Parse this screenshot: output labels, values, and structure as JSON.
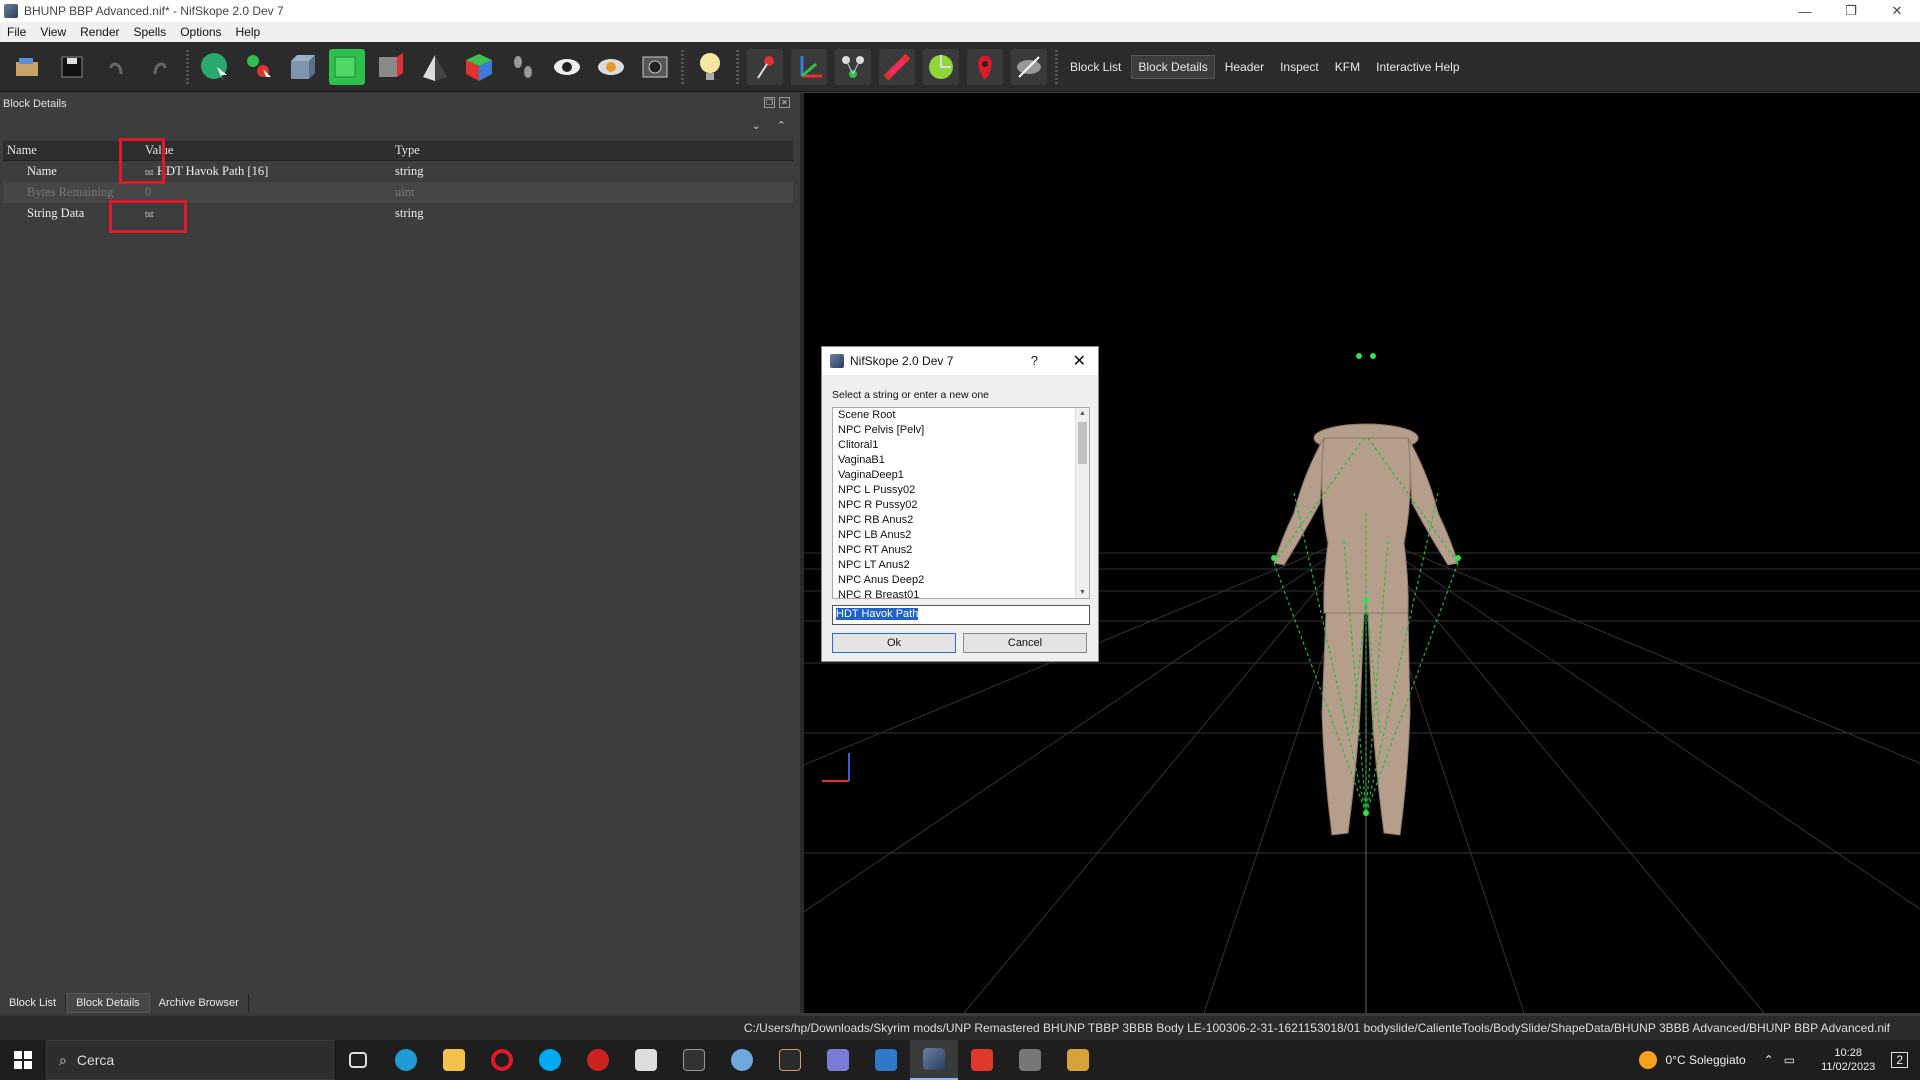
{
  "window": {
    "title": "BHUNP BBP Advanced.nif* - NifSkope 2.0 Dev 7",
    "min": "—",
    "restore": "❐",
    "close": "✕"
  },
  "menu": [
    "File",
    "View",
    "Render",
    "Spells",
    "Options",
    "Help"
  ],
  "toolbar": {
    "icons": [
      "load-icon",
      "save-icon",
      "undo-icon",
      "redo-icon",
      "select-icon",
      "transform-icon",
      "cube-icon",
      "green-cube-icon",
      "red-cube-icon",
      "shade-icon",
      "color-cube-icon",
      "footprints-icon",
      "eye-icon",
      "eye-outline-icon",
      "camera-icon",
      "lightbulb-icon",
      "pin-icon",
      "axes-icon",
      "nodes-icon",
      "bone-icon",
      "collision-icon",
      "marker-icon",
      "hidden-icon"
    ],
    "tabs": [
      "Block List",
      "Block Details",
      "Header",
      "Inspect",
      "KFM",
      "Interactive Help"
    ],
    "active_tab": "Block Details"
  },
  "block_details": {
    "title": "Block Details",
    "columns": {
      "name": "Name",
      "value": "Value",
      "type": "Type"
    },
    "rows": [
      {
        "name": "Name",
        "value": "HDT Havok Path [16]",
        "type": "string"
      },
      {
        "name": "Bytes Remaining",
        "value": "0",
        "type": "uint"
      },
      {
        "name": "String Data",
        "value": "",
        "type": "string"
      }
    ],
    "txt_icon": "txt"
  },
  "bottom_tabs": [
    "Block List",
    "Block Details",
    "Archive Browser"
  ],
  "dialog": {
    "title": "NifSkope 2.0 Dev 7",
    "help": "?",
    "close": "✕",
    "prompt": "Select a string or enter a new one",
    "items": [
      "Scene Root",
      "NPC Pelvis [Pelv]",
      "Clitoral1",
      "VaginaB1",
      "VaginaDeep1",
      "NPC L Pussy02",
      "NPC R Pussy02",
      "NPC RB Anus2",
      "NPC LB Anus2",
      "NPC RT Anus2",
      "NPC LT Anus2",
      "NPC Anus Deep2",
      "NPC R Breast01"
    ],
    "input_value": "HDT Havok Path",
    "ok": "Ok",
    "cancel": "Cancel"
  },
  "status": {
    "path": "C:/Users/hp/Downloads/Skyrim mods/UNP Remastered BHUNP TBBP 3BBB Body LE-100306-2-31-1621153018/01 bodyslide/CalienteTools/BodySlide/ShapeData/BHUNP 3BBB Advanced/BHUNP BBP Advanced.nif"
  },
  "taskbar": {
    "search_placeholder": "Cerca",
    "weather": "0°C  Soleggiato",
    "time": "10:28",
    "date": "11/02/2023",
    "notifications": "2"
  }
}
